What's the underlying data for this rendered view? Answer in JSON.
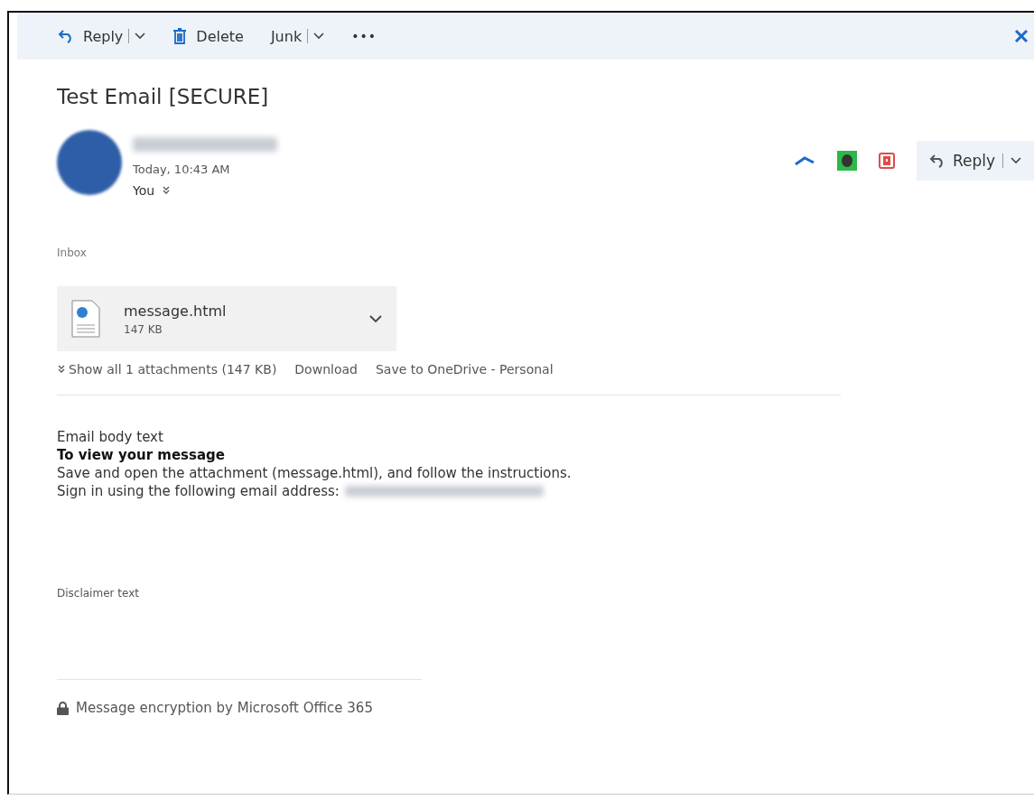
{
  "toolbar": {
    "items": [
      {
        "kind": "reply",
        "label": "Reply"
      },
      {
        "kind": "delete",
        "label": "Delete"
      },
      {
        "kind": "junk",
        "label": "Junk"
      },
      {
        "kind": "more",
        "label": "•••"
      }
    ]
  },
  "message": {
    "subject": "Test Email [SECURE]",
    "time": "Today, 10:43 AM",
    "recipient": "You",
    "reply_label": "Reply",
    "folder": "Inbox"
  },
  "attachment": {
    "name": "message.html",
    "size": "147 KB",
    "links": [
      "Show all 1 attachments (147 KB)",
      "Download",
      "Save to OneDrive - Personal"
    ]
  },
  "body": {
    "intro": "Email body text",
    "heading": "To view your message",
    "instruction": "Save and open the attachment (message.html), and follow the instructions.",
    "sign_in": "Sign in using the following email address:",
    "disclaimer": "Disclaimer text"
  },
  "footer": {
    "text": "Message encryption by Microsoft Office 365"
  }
}
